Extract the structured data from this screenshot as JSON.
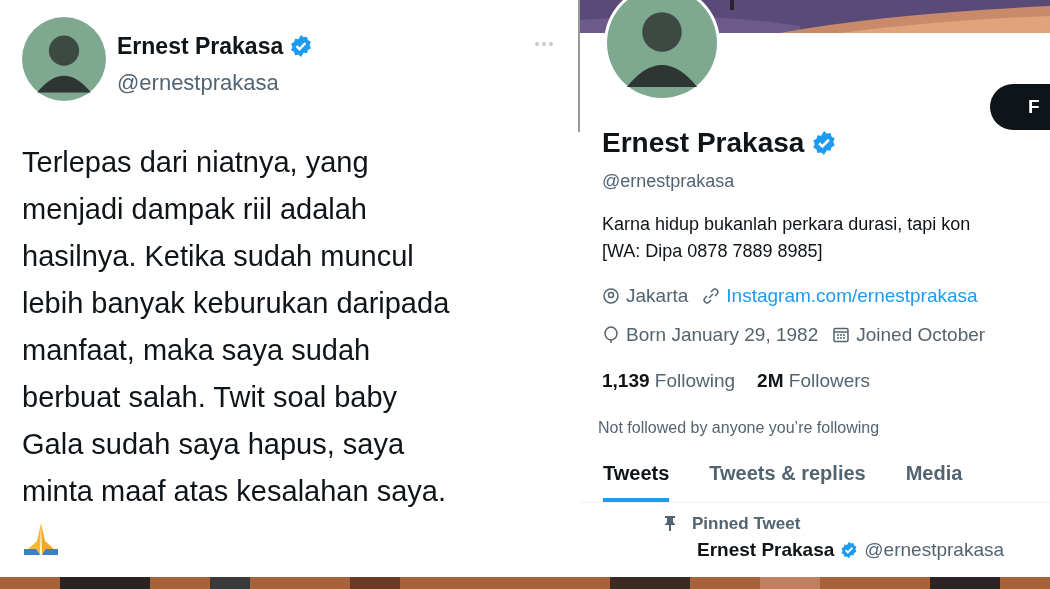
{
  "tweet": {
    "name": "Ernest Prakasa",
    "verified": true,
    "handle": "@ernestprakasa",
    "lines": [
      "Terlepas dari niatnya, yang",
      "menjadi dampak riil adalah",
      "hasilnya. Ketika sudah muncul",
      "lebih banyak keburukan daripada",
      "manfaat, maka saya sudah",
      "berbuat salah. Twit soal baby",
      "Gala sudah saya hapus, saya",
      "minta maaf atas kesalahan saya."
    ]
  },
  "profile": {
    "follow_button": "F",
    "name": "Ernest Prakasa",
    "verified": true,
    "handle": "@ernestprakasa",
    "bio": [
      "Karna hidup bukanlah perkara durasi, tapi kon",
      "[WA: Dipa 0878 7889 8985]"
    ],
    "location": "Jakarta",
    "website": "Instagram.com/ernestprakasa",
    "birthday": "Born January 29, 1982",
    "joined": "Joined October",
    "stats": [
      {
        "count": "1,139",
        "label": "Following"
      },
      {
        "count": "2M",
        "label": "Followers"
      }
    ],
    "followed_by": "Not followed by anyone you’re following",
    "tabs": [
      {
        "label": "Tweets",
        "selected": true
      },
      {
        "label": "Tweets & replies",
        "selected": false
      },
      {
        "label": "Media",
        "selected": false
      }
    ],
    "pinned": {
      "label": "Pinned Tweet",
      "name": "Ernest Prakasa",
      "verified": true,
      "handle": "@ernestprakasa"
    }
  }
}
